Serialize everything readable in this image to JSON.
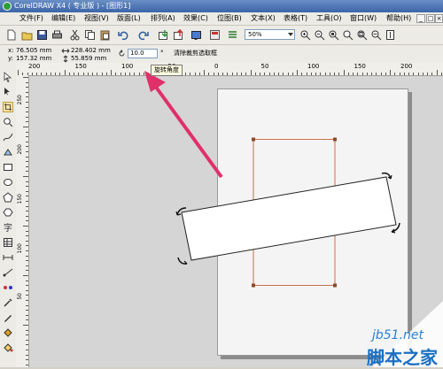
{
  "window": {
    "title": "CorelDRAW X4 ( 专业版 ) - [图形1]"
  },
  "menu": {
    "items": [
      "文件(F)",
      "编辑(E)",
      "视图(V)",
      "版面(L)",
      "排列(A)",
      "效果(C)",
      "位图(B)",
      "文本(X)",
      "表格(T)",
      "工具(O)",
      "窗口(W)",
      "帮助(H)"
    ]
  },
  "toolbar": {
    "zoom_value": "50%"
  },
  "property_bar": {
    "x_label": "x:",
    "x_value": "76.505 mm",
    "y_label": "y:",
    "y_value": "157.32 mm",
    "width_value": "228.402 mm",
    "height_value": "55.859 mm",
    "rotation_value": "10.0",
    "degree_symbol": "°",
    "clear_transform_label": "清除裁剪选取框"
  },
  "tooltip": {
    "text": "旋转角度"
  },
  "rulers": {
    "horizontal_labels": [
      "200",
      "150",
      "100",
      "50",
      "0",
      "50",
      "100",
      "150",
      "200",
      "250"
    ],
    "vertical_labels": [
      "250",
      "200",
      "150",
      "100",
      "50"
    ]
  },
  "watermark": {
    "line1": "jb51.net",
    "line2": "脚本之家"
  },
  "colors": {
    "arrow": "#e0306a",
    "outline": "#c8704a",
    "selection": "#222222"
  }
}
